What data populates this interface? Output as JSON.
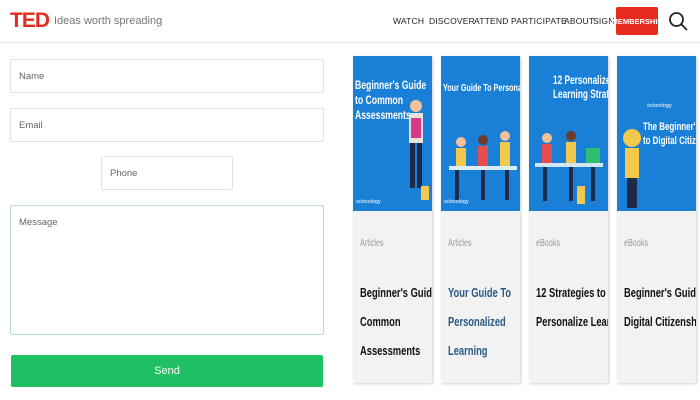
{
  "header": {
    "logo": "TED",
    "tagline": "Ideas worth spreading",
    "nav": [
      "WATCH",
      "DISCOVER",
      "ATTEND",
      "PARTICIPATE",
      "ABOUT",
      "SIGN IN"
    ],
    "membership": "MEMBERSHIP"
  },
  "form": {
    "name_placeholder": "Name",
    "email_placeholder": "Email",
    "phone_placeholder": "Phone",
    "message_placeholder": "Message",
    "send_label": "Send"
  },
  "cards": [
    {
      "image_lines": [
        "Beginner's Guide",
        "to Common",
        "Assessments"
      ],
      "image_brand": "schoology",
      "category": "Articles",
      "title_lines": [
        "Beginner's Guide to",
        "Common",
        "Assessments"
      ]
    },
    {
      "image_lines": [
        "Your Guide To Personalized Learning"
      ],
      "image_brand": "schoology",
      "category": "Articles",
      "title_lines": [
        "Your Guide To",
        "Personalized",
        "Learning"
      ]
    },
    {
      "image_lines": [
        "12 Personalized",
        "Learning Strategies"
      ],
      "image_brand": "",
      "category": "eBooks",
      "title_lines": [
        "12 Strategies to",
        "Personalize Learning"
      ]
    },
    {
      "image_lines": [
        "The Beginner's Guide",
        "to Digital Citizenship"
      ],
      "image_brand": "schoology",
      "category": "eBooks",
      "title_lines": [
        "Beginner's Guide to",
        "Digital Citizenship"
      ]
    }
  ],
  "colors": {
    "ted_red": "#e62b1e",
    "send_green": "#1fc164",
    "card_blue": "#1a7fd6",
    "link_blue": "#2a5a86"
  }
}
